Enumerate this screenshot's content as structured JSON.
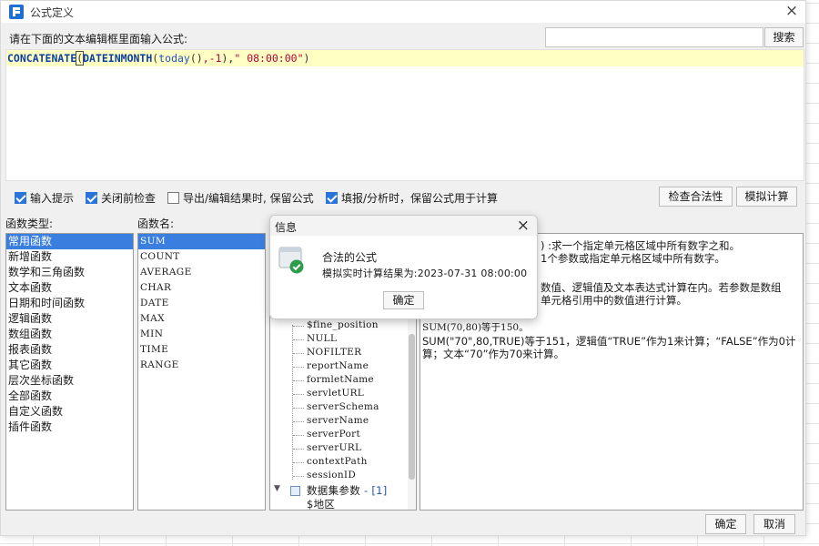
{
  "window": {
    "title": "公式定义",
    "close_icon": "×"
  },
  "prompt": "请在下面的文本编辑框里面输入公式:",
  "search": {
    "value": "",
    "placeholder": "",
    "button": "搜索"
  },
  "formula_tokens": [
    {
      "text": "CONCATENATE",
      "cls": "tk-fn"
    },
    {
      "text": "(",
      "cls": "tk-paren-hl"
    },
    {
      "text": "DATEINMONTH",
      "cls": "tk-fn"
    },
    {
      "text": "(",
      "cls": "tk-punct"
    },
    {
      "text": "today",
      "cls": "tk-call"
    },
    {
      "text": "()",
      "cls": "tk-punct"
    },
    {
      "text": ",-1",
      "cls": "tk-num"
    },
    {
      "text": "),",
      "cls": "tk-punct"
    },
    {
      "text": "\" 08:00:00\"",
      "cls": "tk-str"
    },
    {
      "text": ")",
      "cls": "tk-punct"
    }
  ],
  "options": {
    "input_hint": {
      "label": "输入提示",
      "checked": true
    },
    "check_before_close": {
      "label": "关闭前检查",
      "checked": true
    },
    "keep_formula_export": {
      "label": "导出/编辑结果时, 保留公式",
      "checked": false
    },
    "keep_formula_fill": {
      "label": "填报/分析时，保留公式用于计算",
      "checked": true
    },
    "check_validity_button": "检查合法性",
    "simulate_button": "模拟计算"
  },
  "function_types": {
    "label": "函数类型:",
    "items": [
      "常用函数",
      "新增函数",
      "数学和三角函数",
      "文本函数",
      "日期和时间函数",
      "逻辑函数",
      "数组函数",
      "报表函数",
      "其它函数",
      "层次坐标函数",
      "全部函数",
      "自定义函数",
      "插件函数"
    ],
    "selected": 0
  },
  "function_names": {
    "label": "函数名:",
    "items": [
      "SUM",
      "COUNT",
      "AVERAGE",
      "CHAR",
      "DATE",
      "MAX",
      "MIN",
      "TIME",
      "RANGE"
    ],
    "selected": 0
  },
  "params_tree": {
    "items": [
      "$fine_position",
      "NULL",
      "NOFILTER",
      "reportName",
      "formletName",
      "servletURL",
      "serverSchema",
      "serverName",
      "serverPort",
      "serverURL",
      "contextPath",
      "sessionID"
    ],
    "group": {
      "label": "数据集参数",
      "count": "- [1]"
    },
    "group_child": "$地区"
  },
  "description": {
    "line1": ") :求一个指定单元格区域中所有数字之和。",
    "line2": "1个参数或指定单元格区域中所有数字。",
    "line3": "数值、逻辑值及文本表达式计算在内。若参数是数组",
    "line4": "单元格引用中的数值进行计算。",
    "example1": "SUM(70,80)等于150。",
    "example2": "SUM(\"70\",80,TRUE)等于151，逻辑值“TRUE”作为1来计算；“FALSE”作为0计",
    "example3": "算；文本“70”作为70来计算。"
  },
  "footer": {
    "ok": "确定",
    "cancel": "取消"
  },
  "message_box": {
    "title": "信息",
    "close_icon": "×",
    "line1": "合法的公式",
    "line2": "模拟实时计算结果为:2023-07-31 08:00:00",
    "ok": "确定",
    "icon": "success-check-icon"
  }
}
